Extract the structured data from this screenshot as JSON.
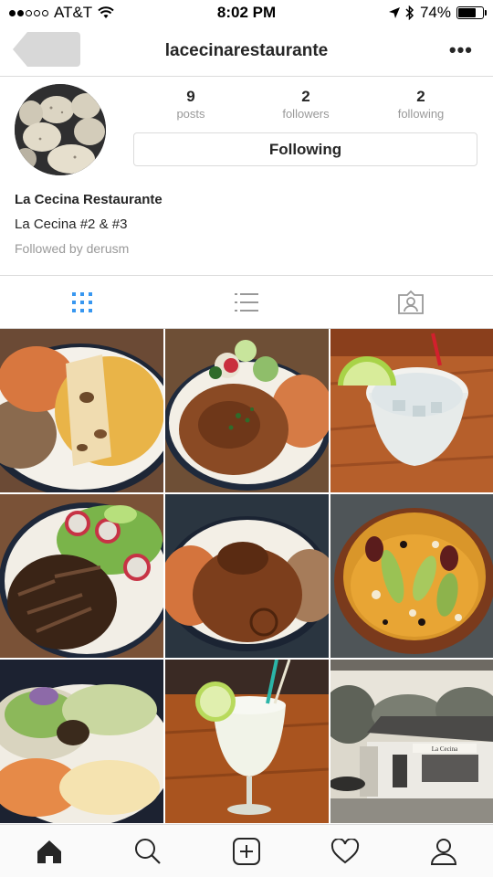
{
  "status_bar": {
    "carrier": "AT&T",
    "time": "8:02 PM",
    "battery": "74%",
    "battery_level": 0.74,
    "signal_bars_filled": 2,
    "signal_bars_total": 5
  },
  "header": {
    "title": "lacecinarestaurante",
    "more_label": "•••"
  },
  "profile": {
    "stats": [
      {
        "value": "9",
        "label": "posts"
      },
      {
        "value": "2",
        "label": "followers"
      },
      {
        "value": "2",
        "label": "following"
      }
    ],
    "follow_button_label": "Following",
    "name": "La Cecina Restaurante",
    "bio": "La Cecina #2 & #3",
    "followed_by": "Followed by derusm"
  },
  "view_tabs": [
    {
      "icon": "grid-icon",
      "active": true
    },
    {
      "icon": "list-icon",
      "active": false
    },
    {
      "icon": "tagged-icon",
      "active": false
    }
  ],
  "grid_posts": [
    {
      "subject": "enchiladas-with-rice-and-beans"
    },
    {
      "subject": "mole-plate-with-rice"
    },
    {
      "subject": "margarita-on-the-rocks"
    },
    {
      "subject": "cecina-steak-with-salad"
    },
    {
      "subject": "mole-with-rice-and-beans"
    },
    {
      "subject": "soup-in-clay-bowl"
    },
    {
      "subject": "tacos-with-rice"
    },
    {
      "subject": "frozen-margarita"
    },
    {
      "subject": "restaurant-storefront"
    }
  ],
  "storefront_sign": "La Cecina",
  "bottom_nav": [
    {
      "icon": "home-icon",
      "active": true
    },
    {
      "icon": "search-icon",
      "active": false
    },
    {
      "icon": "add-post-icon",
      "active": false
    },
    {
      "icon": "heart-icon",
      "active": false
    },
    {
      "icon": "profile-icon",
      "active": false
    }
  ],
  "colors": {
    "accent_blue": "#3897f0",
    "border": "#dbdbdb",
    "text_primary": "#262626",
    "text_secondary": "#999999"
  }
}
